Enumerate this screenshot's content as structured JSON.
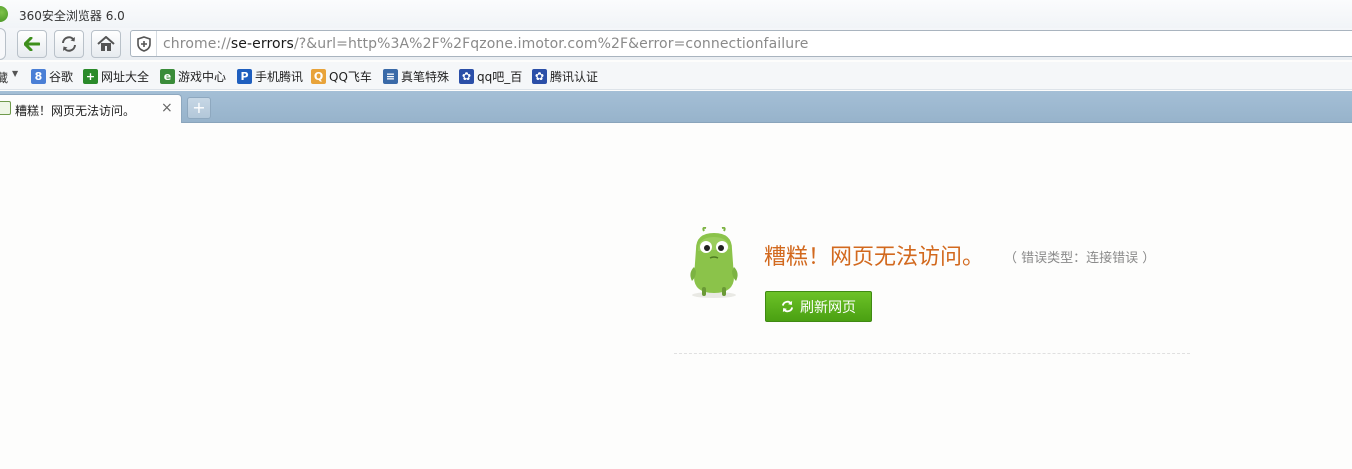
{
  "window": {
    "title": "360安全浏览器 6.0"
  },
  "toolbar": {
    "back_icon": "back-arrow-icon",
    "refresh_icon": "refresh-icon",
    "home_icon": "home-icon",
    "shield_icon": "shield-icon",
    "address": {
      "scheme": "chrome://",
      "host": "se-errors",
      "rest": "/?&url=http%3A%2F%2Fqzone.imotor.com%2F&error=connectionfailure"
    }
  },
  "bookmarks": {
    "favorites_label": "藏",
    "items": [
      {
        "label": "谷歌",
        "icon": "google-icon",
        "color": "#4a7fd6",
        "glyph": "8"
      },
      {
        "label": "网址大全",
        "icon": "sites-icon",
        "color": "#2a8a2a",
        "glyph": "+"
      },
      {
        "label": "游戏中心",
        "icon": "ie-icon",
        "color": "#3a8c3a",
        "glyph": "e"
      },
      {
        "label": "手机腾讯",
        "icon": "p-icon",
        "color": "#1f5fbf",
        "glyph": "P"
      },
      {
        "label": "QQ飞车",
        "icon": "qq-speed-icon",
        "color": "#e8a33a",
        "glyph": "Q"
      },
      {
        "label": "真笔特殊",
        "icon": "page-icon",
        "color": "#3a6aa8",
        "glyph": "≡"
      },
      {
        "label": "qq吧_百",
        "icon": "baidu-paw-icon",
        "color": "#2b4fa8",
        "glyph": "✿"
      },
      {
        "label": "腾讯认证",
        "icon": "baidu-paw-icon",
        "color": "#2b4fa8",
        "glyph": "✿"
      }
    ]
  },
  "tab": {
    "title": "糟糕！网页无法访问。",
    "close": "×",
    "new_tab": "+"
  },
  "error": {
    "title": "糟糕！网页无法访问。",
    "type": "（ 错误类型：连接错误 ）",
    "refresh_label": "刷新网页",
    "title_color": "#d2691e",
    "button_color": "#5ab31c"
  }
}
